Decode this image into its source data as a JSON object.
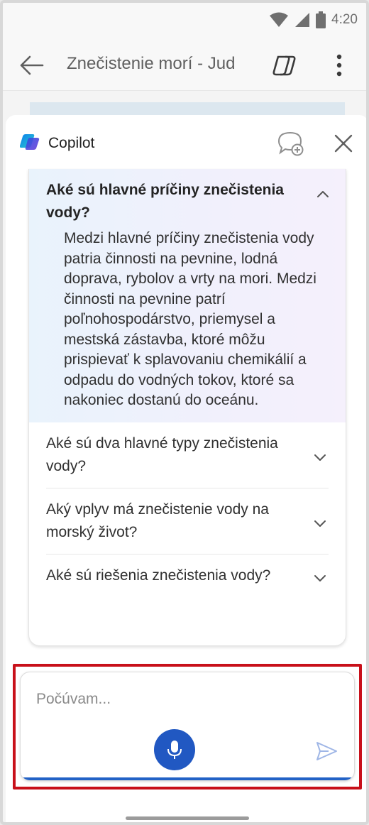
{
  "status_bar": {
    "time": "4:20"
  },
  "app_bar": {
    "title": "Znečistenie morí - Jud"
  },
  "copilot": {
    "title": "Copilot",
    "faqs": [
      {
        "question": "Aké sú hlavné príčiny znečistenia vody?",
        "answer": "Medzi hlavné príčiny znečistenia vody patria činnosti na pevnine, lodná doprava, rybolov a vrty na mori. Medzi činnosti na pevnine patrí poľnohospodárstvo, priemysel a mestská zástavba, ktoré môžu prispievať k splavovaniu chemikálií a odpadu do vodných tokov, ktoré sa nakoniec dostanú do oceánu.",
        "expanded": true
      },
      {
        "question": "Aké sú dva hlavné typy znečistenia vody?",
        "expanded": false
      },
      {
        "question": "Aký vplyv má znečistenie vody na morský život?",
        "expanded": false
      },
      {
        "question": "Aké sú riešenia znečistenia vody?",
        "expanded": false
      }
    ]
  },
  "input": {
    "placeholder": "Počúvam..."
  },
  "colors": {
    "accent": "#2158c2",
    "highlight": "#c8101a"
  },
  "icons": [
    "wifi-icon",
    "signal-icon",
    "battery-icon",
    "back-arrow-icon",
    "copilot-icon",
    "more-vert-icon",
    "new-chat-icon",
    "close-icon",
    "chevron-up-icon",
    "chevron-down-icon",
    "microphone-icon",
    "send-icon"
  ]
}
